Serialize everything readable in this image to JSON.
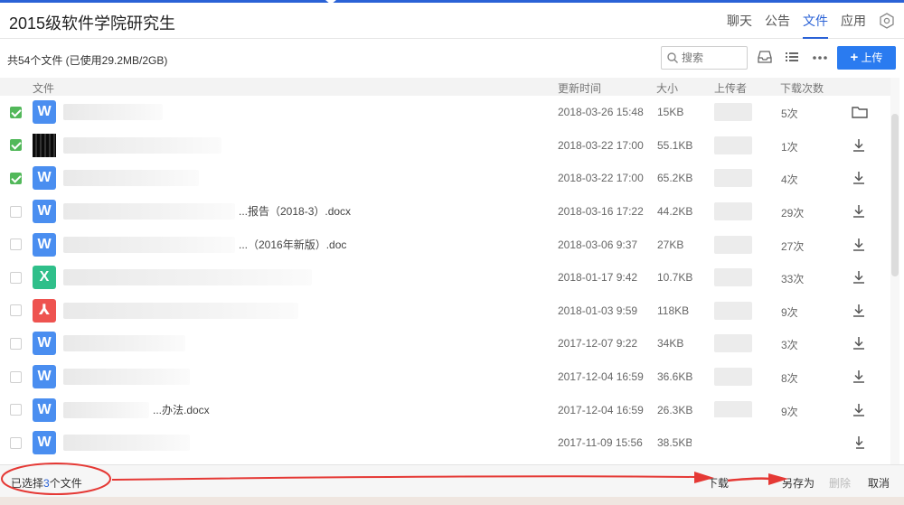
{
  "header": {
    "group_title": "2015级软件学院研究生",
    "tabs": [
      {
        "label": "聊天",
        "active": false
      },
      {
        "label": "公告",
        "active": false
      },
      {
        "label": "文件",
        "active": true
      },
      {
        "label": "应用",
        "active": false
      }
    ],
    "settings_icon": "settings-hexagon-icon"
  },
  "toolbar": {
    "summary": "共54个文件 (已使用29.2MB/2GB)",
    "search_placeholder": "搜索",
    "upload_label": "上传",
    "upload_icon": "plus-icon",
    "view_icons": [
      "inbox-icon",
      "list-view-icon",
      "more-icon"
    ]
  },
  "columns": {
    "file": "文件",
    "updated": "更新时间",
    "size": "大小",
    "uploader": "上传者",
    "downloads": "下载次数"
  },
  "files": [
    {
      "checked": true,
      "type": "word",
      "name": "",
      "updated": "2018-03-26 15:48",
      "size": "15KB",
      "downloads": "5次",
      "action": "folder-icon"
    },
    {
      "checked": true,
      "type": "image",
      "name": "",
      "updated": "2018-03-22 17:00",
      "size": "55.1KB",
      "downloads": "1次",
      "action": "download-icon"
    },
    {
      "checked": true,
      "type": "word",
      "name": "",
      "updated": "2018-03-22 17:00",
      "size": "65.2KB",
      "downloads": "4次",
      "action": "download-icon"
    },
    {
      "checked": false,
      "type": "word",
      "name": "...报告（2018-3）.docx",
      "updated": "2018-03-16 17:22",
      "size": "44.2KB",
      "downloads": "29次",
      "action": "download-icon"
    },
    {
      "checked": false,
      "type": "word",
      "name": "...（2016年新版）.doc",
      "updated": "2018-03-06 9:37",
      "size": "27KB",
      "downloads": "27次",
      "action": "download-icon"
    },
    {
      "checked": false,
      "type": "excel",
      "name": "",
      "updated": "2018-01-17 9:42",
      "size": "10.7KB",
      "downloads": "33次",
      "action": "download-icon"
    },
    {
      "checked": false,
      "type": "pdf",
      "name": "",
      "updated": "2018-01-03 9:59",
      "size": "118KB",
      "downloads": "9次",
      "action": "download-icon"
    },
    {
      "checked": false,
      "type": "word",
      "name": "",
      "updated": "2017-12-07 9:22",
      "size": "34KB",
      "downloads": "3次",
      "action": "download-icon"
    },
    {
      "checked": false,
      "type": "word",
      "name": "",
      "updated": "2017-12-04 16:59",
      "size": "36.6KB",
      "downloads": "8次",
      "action": "download-icon"
    },
    {
      "checked": false,
      "type": "word",
      "name": "...办法.docx",
      "updated": "2017-12-04 16:59",
      "size": "26.3KB",
      "downloads": "9次",
      "action": "download-icon"
    },
    {
      "checked": false,
      "type": "word",
      "name": "",
      "updated": "2017-11-09 15:56",
      "size": "38.5KB",
      "downloads": "",
      "action": "download-icon"
    }
  ],
  "footer": {
    "selected_prefix": "已选择",
    "selected_count": "3",
    "selected_suffix": "个文件",
    "download": "下载",
    "save_as": "另存为",
    "delete": "删除",
    "cancel": "取消"
  },
  "colors": {
    "accent": "#2a62d6",
    "upload": "#2a7bf0",
    "checked": "#52b85a",
    "annotation": "#e53935"
  }
}
